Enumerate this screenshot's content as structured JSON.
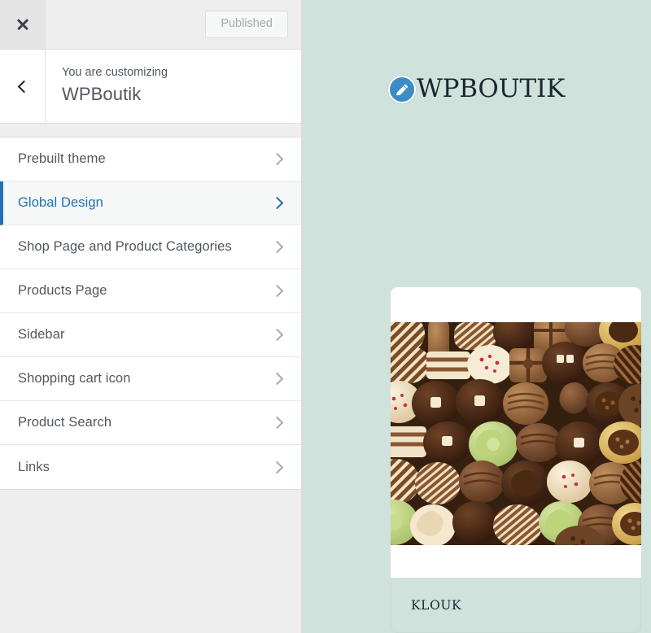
{
  "customizer": {
    "close_icon": "close-x-icon",
    "back_icon": "chevron-left-icon",
    "publish_button": "Published",
    "subtitle": "You are customizing",
    "site_title": "WPBoutik",
    "accent_color": "#2271b1",
    "panel_bg": "#eeeeee",
    "items": [
      {
        "label": "Prebuilt theme",
        "active": false
      },
      {
        "label": "Global Design",
        "active": true
      },
      {
        "label": "Shop Page and Product Categories",
        "active": false
      },
      {
        "label": "Products Page",
        "active": false
      },
      {
        "label": "Sidebar",
        "active": false
      },
      {
        "label": "Shopping cart icon",
        "active": false
      },
      {
        "label": "Product Search",
        "active": false
      },
      {
        "label": "Links",
        "active": false
      }
    ]
  },
  "preview": {
    "background_color": "#cfe2db",
    "brand": {
      "logo_icon": "pencil-edit-icon",
      "logo_color": "#3c8dc5",
      "name": "WPBOUTIK"
    },
    "product": {
      "image_alt": "assorted-chocolates-photo",
      "title": "KLOUK"
    }
  }
}
